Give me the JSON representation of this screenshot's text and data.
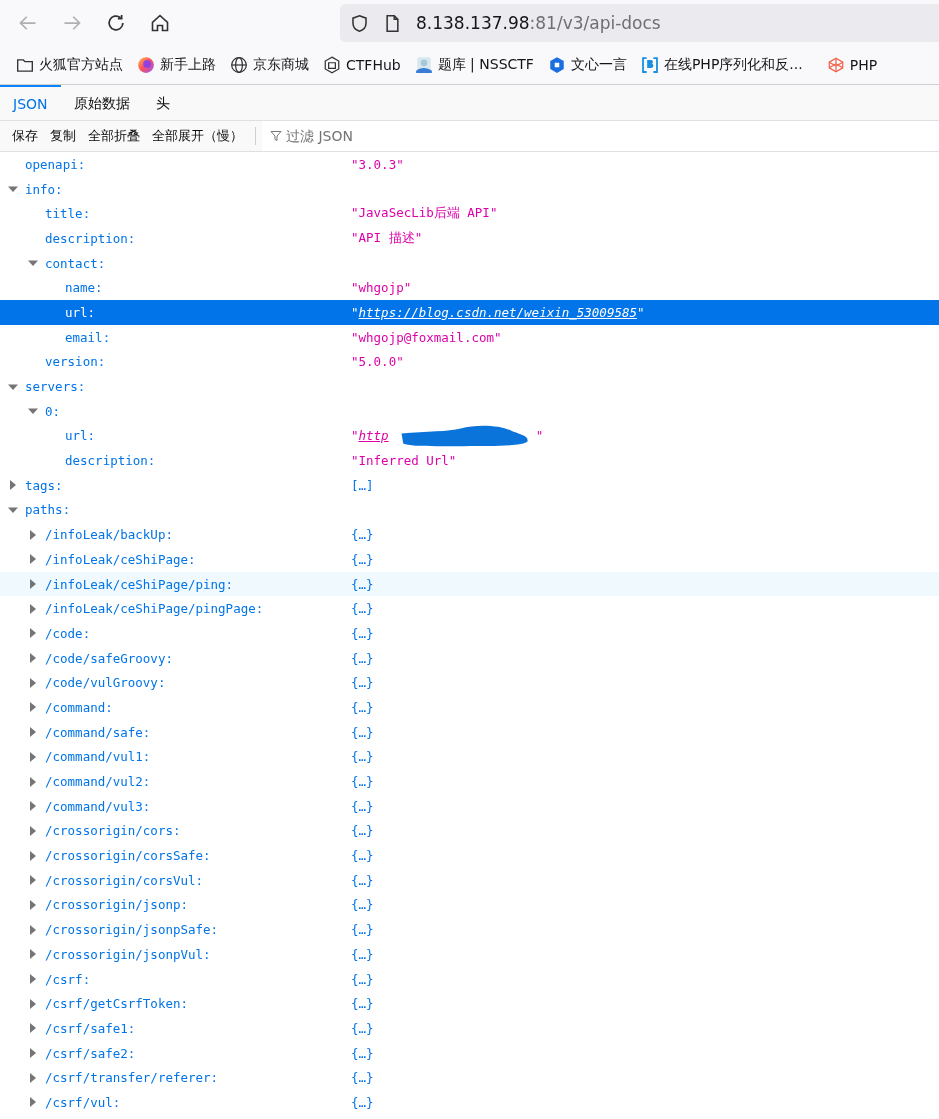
{
  "address_bar": {
    "host": "8.138.137.98",
    "rest": ":81/v3/api-docs"
  },
  "bookmarks": [
    {
      "label": "火狐官方站点",
      "kind": "folder"
    },
    {
      "label": "新手上路",
      "kind": "firefox"
    },
    {
      "label": "京东商城",
      "kind": "globe"
    },
    {
      "label": "CTFHub",
      "kind": "hex"
    },
    {
      "label": "题库 | NSSCTF",
      "kind": "image"
    },
    {
      "label": "文心一言",
      "kind": "cube"
    },
    {
      "label": "在线PHP序列化和反...",
      "kind": "letter-box"
    },
    {
      "label": "PHP",
      "kind": "wire-cube"
    }
  ],
  "tabs": [
    {
      "label": "JSON",
      "selected": true
    },
    {
      "label": "原始数据",
      "selected": false
    },
    {
      "label": "头",
      "selected": false
    }
  ],
  "toolbar": {
    "buttons": [
      "保存",
      "复制",
      "全部折叠",
      "全部展开（慢）"
    ],
    "filter_placeholder": "过滤 JSON"
  },
  "json_tree": [
    {
      "key": "openapi:",
      "kind": "string",
      "value": "\"3.0.3\"",
      "selected": false,
      "hovered": false
    },
    {
      "key": "info:",
      "kind": "object",
      "expanded": true,
      "selected": false,
      "hovered": false,
      "children": [
        {
          "key": "title:",
          "kind": "string",
          "value": "\"JavaSecLib后端 API\"",
          "selected": false,
          "hovered": false
        },
        {
          "key": "description:",
          "kind": "string",
          "value": "\"API 描述\"",
          "selected": false,
          "hovered": false
        },
        {
          "key": "contact:",
          "kind": "object",
          "expanded": true,
          "selected": false,
          "hovered": false,
          "children": [
            {
              "key": "name:",
              "kind": "string",
              "value": "\"whgojp\"",
              "selected": false,
              "hovered": false
            },
            {
              "key": "url:",
              "kind": "url",
              "quote_open": "\"",
              "link": "https://blog.csdn.net/weixin_53009585",
              "quote_close": "\"",
              "redacted": false,
              "selected": true,
              "hovered": false
            },
            {
              "key": "email:",
              "kind": "string",
              "value": "\"whgojp@foxmail.com\"",
              "selected": false,
              "hovered": false
            }
          ]
        },
        {
          "key": "version:",
          "kind": "string",
          "value": "\"5.0.0\"",
          "selected": false,
          "hovered": false
        }
      ]
    },
    {
      "key": "servers:",
      "kind": "object",
      "expanded": true,
      "selected": false,
      "hovered": false,
      "children": [
        {
          "key": "0:",
          "kind": "object",
          "expanded": true,
          "selected": false,
          "hovered": false,
          "children": [
            {
              "key": "url:",
              "kind": "url",
              "quote_open": "\"",
              "link": "http",
              "quote_close": "\"",
              "redacted": true,
              "selected": false,
              "hovered": false
            },
            {
              "key": "description:",
              "kind": "string",
              "value": "\"Inferred Url\"",
              "selected": false,
              "hovered": false
            }
          ]
        }
      ]
    },
    {
      "key": "tags:",
      "kind": "object",
      "expanded": false,
      "value": "[…]",
      "selected": false,
      "hovered": false
    },
    {
      "key": "paths:",
      "kind": "object",
      "expanded": true,
      "selected": false,
      "hovered": false,
      "children": [
        {
          "key": "/infoLeak/backUp:",
          "kind": "object",
          "expanded": false,
          "value": "{…}",
          "selected": false,
          "hovered": false
        },
        {
          "key": "/infoLeak/ceShiPage:",
          "kind": "object",
          "expanded": false,
          "value": "{…}",
          "selected": false,
          "hovered": false
        },
        {
          "key": "/infoLeak/ceShiPage/ping:",
          "kind": "object",
          "expanded": false,
          "value": "{…}",
          "selected": false,
          "hovered": true
        },
        {
          "key": "/infoLeak/ceShiPage/pingPage:",
          "kind": "object",
          "expanded": false,
          "value": "{…}",
          "selected": false,
          "hovered": false
        },
        {
          "key": "/code:",
          "kind": "object",
          "expanded": false,
          "value": "{…}",
          "selected": false,
          "hovered": false
        },
        {
          "key": "/code/safeGroovy:",
          "kind": "object",
          "expanded": false,
          "value": "{…}",
          "selected": false,
          "hovered": false
        },
        {
          "key": "/code/vulGroovy:",
          "kind": "object",
          "expanded": false,
          "value": "{…}",
          "selected": false,
          "hovered": false
        },
        {
          "key": "/command:",
          "kind": "object",
          "expanded": false,
          "value": "{…}",
          "selected": false,
          "hovered": false
        },
        {
          "key": "/command/safe:",
          "kind": "object",
          "expanded": false,
          "value": "{…}",
          "selected": false,
          "hovered": false
        },
        {
          "key": "/command/vul1:",
          "kind": "object",
          "expanded": false,
          "value": "{…}",
          "selected": false,
          "hovered": false
        },
        {
          "key": "/command/vul2:",
          "kind": "object",
          "expanded": false,
          "value": "{…}",
          "selected": false,
          "hovered": false
        },
        {
          "key": "/command/vul3:",
          "kind": "object",
          "expanded": false,
          "value": "{…}",
          "selected": false,
          "hovered": false
        },
        {
          "key": "/crossorigin/cors:",
          "kind": "object",
          "expanded": false,
          "value": "{…}",
          "selected": false,
          "hovered": false
        },
        {
          "key": "/crossorigin/corsSafe:",
          "kind": "object",
          "expanded": false,
          "value": "{…}",
          "selected": false,
          "hovered": false
        },
        {
          "key": "/crossorigin/corsVul:",
          "kind": "object",
          "expanded": false,
          "value": "{…}",
          "selected": false,
          "hovered": false
        },
        {
          "key": "/crossorigin/jsonp:",
          "kind": "object",
          "expanded": false,
          "value": "{…}",
          "selected": false,
          "hovered": false
        },
        {
          "key": "/crossorigin/jsonpSafe:",
          "kind": "object",
          "expanded": false,
          "value": "{…}",
          "selected": false,
          "hovered": false
        },
        {
          "key": "/crossorigin/jsonpVul:",
          "kind": "object",
          "expanded": false,
          "value": "{…}",
          "selected": false,
          "hovered": false
        },
        {
          "key": "/csrf:",
          "kind": "object",
          "expanded": false,
          "value": "{…}",
          "selected": false,
          "hovered": false
        },
        {
          "key": "/csrf/getCsrfToken:",
          "kind": "object",
          "expanded": false,
          "value": "{…}",
          "selected": false,
          "hovered": false
        },
        {
          "key": "/csrf/safe1:",
          "kind": "object",
          "expanded": false,
          "value": "{…}",
          "selected": false,
          "hovered": false
        },
        {
          "key": "/csrf/safe2:",
          "kind": "object",
          "expanded": false,
          "value": "{…}",
          "selected": false,
          "hovered": false
        },
        {
          "key": "/csrf/transfer/referer:",
          "kind": "object",
          "expanded": false,
          "value": "{…}",
          "selected": false,
          "hovered": false
        },
        {
          "key": "/csrf/vul:",
          "kind": "object",
          "expanded": false,
          "value": "{…}",
          "selected": false,
          "hovered": false
        }
      ]
    }
  ]
}
